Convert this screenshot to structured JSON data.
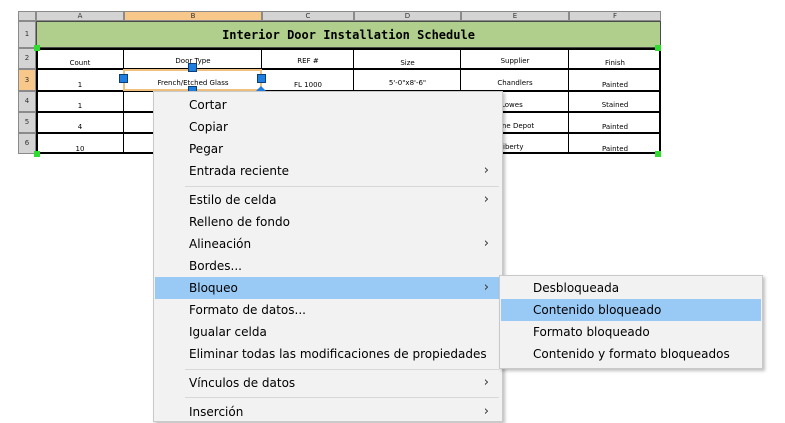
{
  "sheet": {
    "columns": [
      "A",
      "B",
      "C",
      "D",
      "E",
      "F"
    ],
    "rows": [
      "1",
      "2",
      "3",
      "4",
      "5",
      "6"
    ],
    "title": "Interior Door Installation Schedule",
    "headers": [
      "Count",
      "Door Type",
      "REF #",
      "Size",
      "Supplier",
      "Finish"
    ],
    "data": [
      [
        "1",
        "French/Etched Glass",
        "FL 1000",
        "5'-0\"x8'-6\"",
        "Chandlers",
        "Painted"
      ],
      [
        "1",
        "",
        "",
        "",
        "Lowes",
        "Stained"
      ],
      [
        "4",
        "",
        "",
        "",
        "ne Depot",
        "Painted"
      ],
      [
        "10",
        "",
        "",
        "",
        "iberty",
        "Painted"
      ]
    ]
  },
  "menu": {
    "items": [
      {
        "label": "Cortar",
        "submenu": false
      },
      {
        "label": "Copiar",
        "submenu": false
      },
      {
        "label": "Pegar",
        "submenu": false
      },
      {
        "label": "Entrada reciente",
        "submenu": true
      },
      {
        "label": "Estilo de celda",
        "submenu": true
      },
      {
        "label": "Relleno de fondo",
        "submenu": false
      },
      {
        "label": "Alineación",
        "submenu": true
      },
      {
        "label": "Bordes...",
        "submenu": false
      },
      {
        "label": "Bloqueo",
        "submenu": true
      },
      {
        "label": "Formato de datos...",
        "submenu": false
      },
      {
        "label": "Igualar celda",
        "submenu": false
      },
      {
        "label": "Eliminar todas las modificaciones de propiedades",
        "submenu": false
      },
      {
        "label": "Vínculos de datos",
        "submenu": true
      },
      {
        "label": "Inserción",
        "submenu": true
      }
    ],
    "arrow_glyph": "›"
  },
  "submenu": {
    "items": [
      "Desbloqueada",
      "Contenido bloqueado",
      "Formato bloqueado",
      "Contenido y formato bloqueados"
    ]
  },
  "colors": {
    "title_fill": "#b1cf8c",
    "highlight": "#99c9f5",
    "grip": "#1e7fe0",
    "selection_corner": "#2fdc2f",
    "active_header": "#f7c88a"
  }
}
